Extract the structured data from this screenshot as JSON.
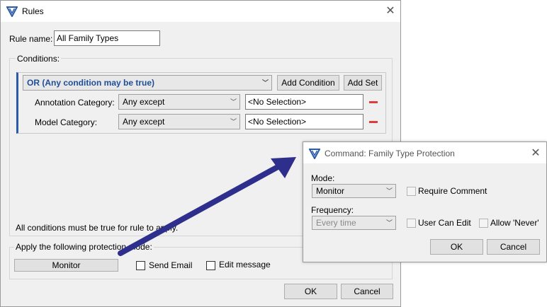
{
  "rules_dialog": {
    "title": "Rules",
    "rule_name_label": "Rule name:",
    "rule_name_value": "All Family Types",
    "conditions_label": "Conditions:",
    "operator_value": "OR (Any condition may be true)",
    "add_condition_label": "Add Condition",
    "add_set_label": "Add Set",
    "conditions": [
      {
        "label": "Annotation Category:",
        "operator": "Any except",
        "value": "<No Selection>"
      },
      {
        "label": "Model Category:",
        "operator": "Any except",
        "value": "<No Selection>"
      }
    ],
    "footer_note": "All conditions must be true for rule to apply.",
    "protection_label": "Apply the following protection mode:",
    "mode_button_label": "Monitor",
    "send_email_label": "Send Email",
    "edit_message_label": "Edit message",
    "ok_label": "OK",
    "cancel_label": "Cancel"
  },
  "command_dialog": {
    "title": "Command: Family Type Protection",
    "mode_label": "Mode:",
    "mode_value": "Monitor",
    "require_comment_label": "Require Comment",
    "frequency_label": "Frequency:",
    "frequency_value": "Every time",
    "user_can_edit_label": "User Can Edit",
    "allow_never_label": "Allow 'Never'",
    "ok_label": "OK",
    "cancel_label": "Cancel"
  },
  "colors": {
    "arrow": "#2e2f8c",
    "accent_bar": "#2b5aa8",
    "operator_text": "#1f4e99",
    "remove_icon": "#e03c3c"
  },
  "icons": {
    "app_logo": "v-shield-logo-icon",
    "close": "close-icon",
    "dropdown": "chevron-down-icon",
    "remove": "minus-icon"
  }
}
